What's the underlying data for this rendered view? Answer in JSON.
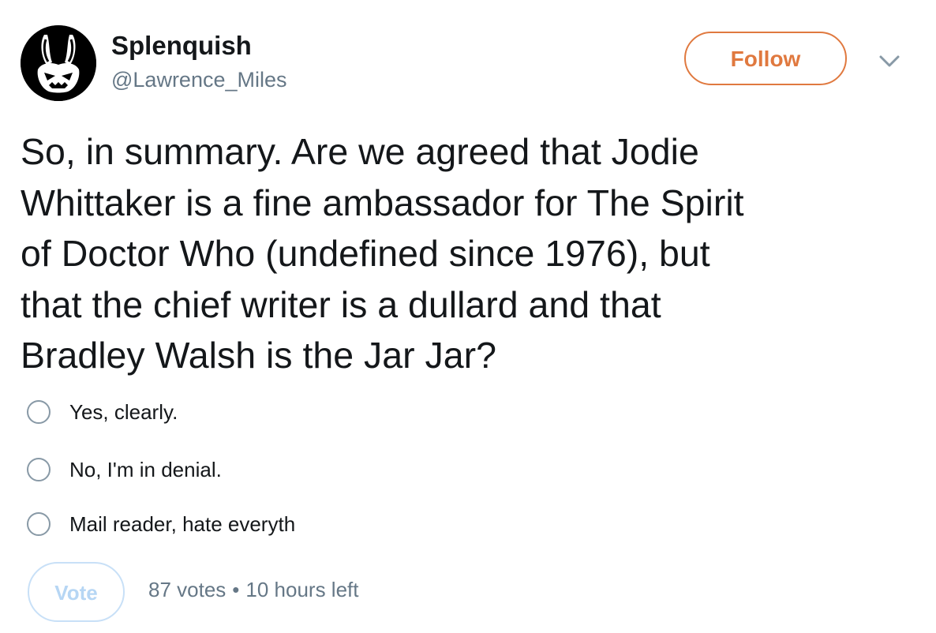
{
  "tweet": {
    "author": {
      "display_name": "Splenquish",
      "handle": "@Lawrence_Miles",
      "avatar_icon": "rabbit-mask-icon"
    },
    "follow_label": "Follow",
    "menu_icon": "chevron-down-icon",
    "accent_color": "#e0793f",
    "text_lines": [
      "So, in summary. Are we agreed that Jodie",
      "Whittaker is a fine ambassador for The Spirit",
      "of Doctor Who (undefined since 1976), but",
      "that the chief writer is a dullard and that",
      "Bradley Walsh is the Jar Jar?"
    ]
  },
  "poll": {
    "options": [
      {
        "label": "Yes, clearly."
      },
      {
        "label": "No, I'm in denial."
      },
      {
        "label": "Mail reader, hate everyth"
      }
    ],
    "vote_label": "Vote",
    "votes": "87 votes",
    "separator": "•",
    "time_left": "10 hours left"
  }
}
